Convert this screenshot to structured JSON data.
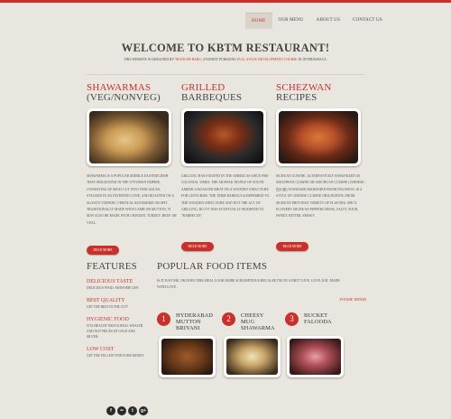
{
  "nav": {
    "items": [
      {
        "label": "HOME",
        "active": true
      },
      {
        "label": "OUR MENU",
        "active": false
      },
      {
        "label": "ABOUT US",
        "active": false
      },
      {
        "label": "CONTACT US",
        "active": false
      }
    ]
  },
  "header": {
    "welcome": "WELCOME TO KBTM RESTAURANT!",
    "designed_prefix": "THIS WEBSITE IS DESIGNED BY",
    "designer": "TRANUSH BABU",
    "designed_mid": ", STUDENT PURSUING",
    "course": "FULL STACK DEVELOPMENT COURSE",
    "designed_suffix": "IN INTERNSHALA."
  },
  "dishes": [
    {
      "title_red": "SHAWARMAS",
      "title_dark": "(VEG/NONVEG)",
      "description": "SHAWARMA IS A POPULAR MIDDLE EASTERN DISH THAT ORIGINATED IN THE OTTOMAN EMPIRE, CONSISTING OF MEAT CUT INTO THIN SLICES, STACKED IN AN INVERTED CONE, AND ROASTED ON A SLOWLY-TURNING VERTICAL ROTISSERIE OR SPIT. TRADITIONALLY MADE WITH LAMB OR MUTTON, IT MAY ALSO BE MADE WITH CHICKEN, TURKEY, BEEF, OR VEAL.",
      "button": "READ MORE"
    },
    {
      "title_red": "GRILLED",
      "title_dark": "BARBEQUES",
      "description": "GRILLING HAS EXISTED IN THE AMERICAS SINCE PRE-COLONIAL TIMES. THE ARAWAK PEOPLE OF SOUTH AMERICA ROASTED MEAT ON A WOODEN STRUCTURE FOR CENTURIES. THE TERM BARBACOA REFERRED TO THE WOODEN STRUCTURE AND NOT THE ACT OF GRILLING, BUT IT WAS EVENTUALLY MODIFIED TO \"BARBECUE\"",
      "button": "READ MORE"
    },
    {
      "title_red": "SCHEZWAN",
      "title_dark": "RECIPES",
      "description": "SICHUAN CUISINE, ALTERNATIVELY ROMANIZED AS SZECHWAN CUISINE OR SZECHUAN CUISINE (CHINESE: 四川菜) STANDARD MANDARIN PRONUNCIATION. IS A STYLE OF CHINESE CUISINE ORIGINATING FROM SICHUAN PROVINCE VARIETY OF FLAVORS: SPICY, FLOWERY (SICHUAN PEPPERCORNS), SALTY, SOUR, SWEET, BITTER, SMOKY.",
      "button": "READ MORE"
    }
  ],
  "features": {
    "title": "FEATURES",
    "items": [
      {
        "title": "DELICIOUS TASTE",
        "desc": "DELICIOUS FOOD, AWESOME LIFE"
      },
      {
        "title": "BEST QUALITY",
        "desc": "GET THE BEST IN THE CITY"
      },
      {
        "title": "HYGIENIC FOOD",
        "desc": "IT IS HEALTH THAT IS REAL WEALTH AND NOT PIECES OF GOLD AND SILVER."
      },
      {
        "title": "LOW COST",
        "desc": "GET THE FULLEST FOR YOUR MONEY"
      }
    ]
  },
  "popular": {
    "title": "POPULAR FOOD ITEMS",
    "desc": "IS IT JUST ME, OR DOES THIS MEAL LOOK MORE SCRUMPTIOUS BECAUSE I'M ON A DIET? LIVE, LOVE, EAT. MADE WITH LOVE.",
    "quote": "-FOODIE TRENDS",
    "items": [
      {
        "num": "1",
        "line1": "HYDERABAD",
        "line2": "MUTTON",
        "line3": "BRIYANI"
      },
      {
        "num": "2",
        "line1": "CHEESY",
        "line2": "MUG",
        "line3": "SHAWARMA"
      },
      {
        "num": "3",
        "line1": "BUCKET",
        "line2": "FALOODA",
        "line3": ""
      }
    ]
  },
  "social": {
    "icons": [
      "facebook-icon",
      "flickr-icon",
      "twitter-icon",
      "google-plus-icon"
    ],
    "glyphs": [
      "f",
      "••",
      "t",
      "g+"
    ]
  },
  "colors": {
    "accent": "#c9302c",
    "background": "#e9e6df"
  }
}
